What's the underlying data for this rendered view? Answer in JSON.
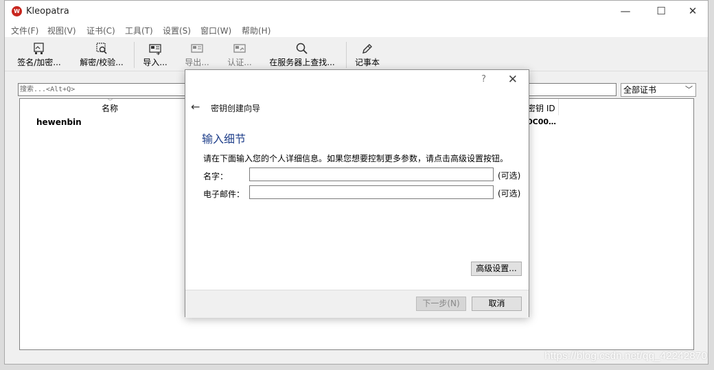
{
  "window": {
    "title": "Kleopatra",
    "logo_text": "W",
    "controls": {
      "minimize": "—",
      "maximize": "☐",
      "close": "✕"
    }
  },
  "menu": [
    {
      "label": "文件(F)"
    },
    {
      "label": "视图(V)"
    },
    {
      "label": "证书(C)"
    },
    {
      "label": "工具(T)"
    },
    {
      "label": "设置(S)"
    },
    {
      "label": "窗口(W)"
    },
    {
      "label": "帮助(H)"
    }
  ],
  "toolbar": [
    {
      "label": "签名/加密...",
      "icon": "sign-encrypt-icon"
    },
    {
      "label": "解密/校验...",
      "icon": "decrypt-verify-icon"
    },
    {
      "label": "导入...",
      "icon": "import-icon"
    },
    {
      "label": "导出...",
      "icon": "export-icon"
    },
    {
      "label": "认证...",
      "icon": "certify-icon"
    },
    {
      "label": "在服务器上查找...",
      "icon": "search-icon"
    },
    {
      "label": "记事本",
      "icon": "pencil-icon"
    }
  ],
  "search": {
    "placeholder": "搜索...<Alt+Q>"
  },
  "filter": {
    "selected": "全部证书"
  },
  "table": {
    "columns": [
      "名称",
      "密钥 ID"
    ],
    "rows": [
      {
        "name": "hewenbin",
        "keyid": "0C00…"
      }
    ]
  },
  "watermark": "https://blog.csdn.net/qq_42242870",
  "dialog": {
    "help": "?",
    "close": "✕",
    "back": "←",
    "wizard_title": "密钥创建向导",
    "heading": "输入细节",
    "instructions": "请在下面输入您的个人详细信息。如果您想要控制更多参数，请点击高级设置按钮。",
    "fields": [
      {
        "label": "名字：",
        "optional": "(可选)",
        "value": ""
      },
      {
        "label": "电子邮件：",
        "optional": "(可选)",
        "value": ""
      }
    ],
    "advanced_button": "高级设置...",
    "next_button": "下一步(N)",
    "cancel_button": "取消"
  }
}
